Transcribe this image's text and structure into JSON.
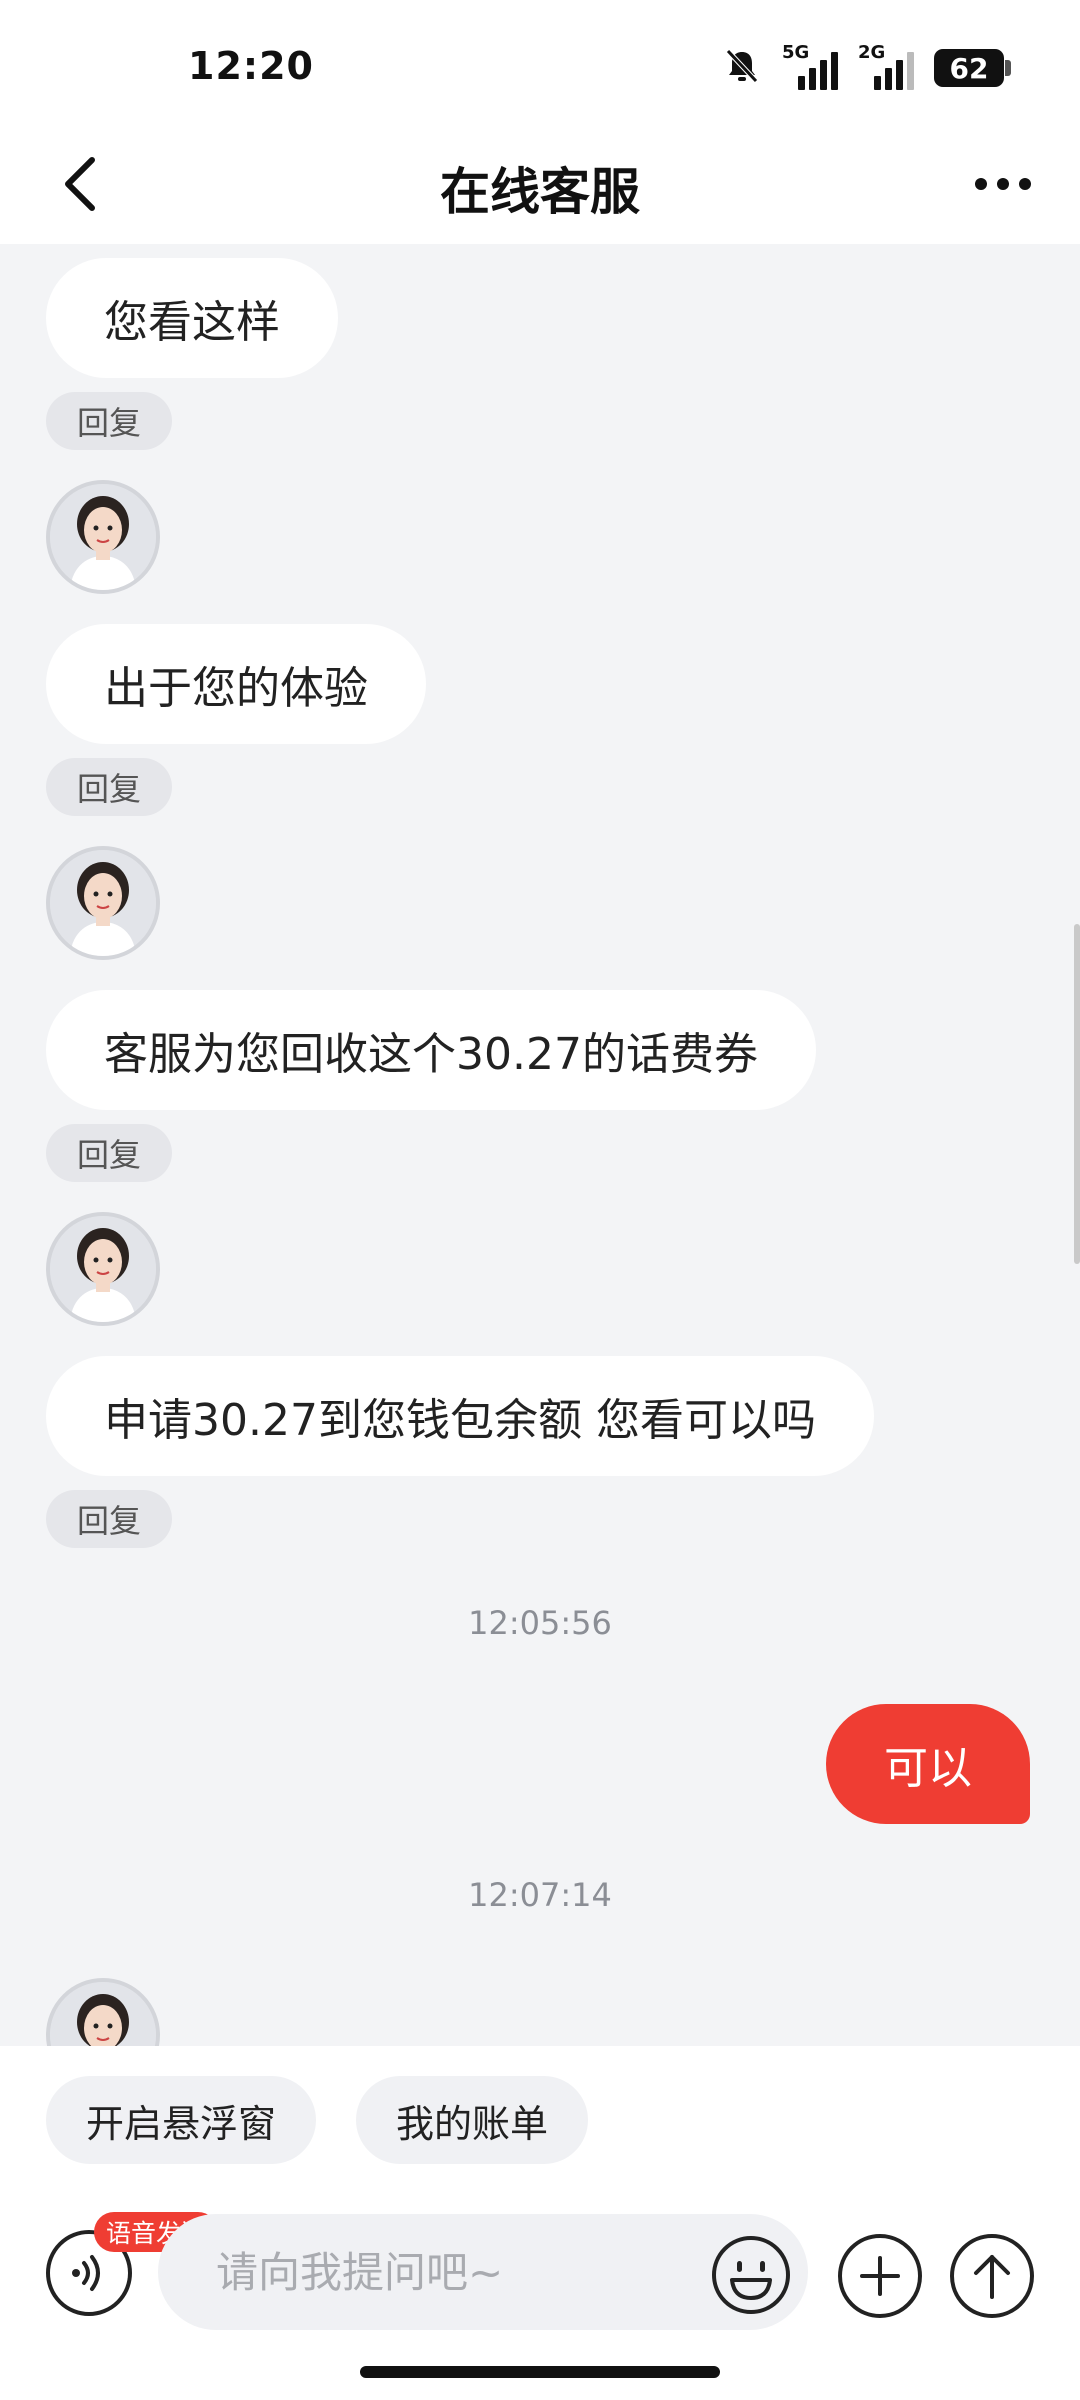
{
  "status_bar": {
    "time": "12:20",
    "signal_1": "5G",
    "signal_2": "2G",
    "battery": "62"
  },
  "nav": {
    "title": "在线客服"
  },
  "chat": {
    "messages": [
      {
        "from": "agent",
        "text": "您看这样",
        "reply": "回复"
      },
      {
        "from": "agent",
        "text": "出于您的体验",
        "reply": "回复"
      },
      {
        "from": "agent",
        "text": "客服为您回收这个30.27的话费券",
        "reply": "回复"
      },
      {
        "from": "agent",
        "text": "申请30.27到您钱包余额 您看可以吗",
        "reply": "回复"
      },
      {
        "from": "timestamp",
        "text": "12:05:56"
      },
      {
        "from": "user",
        "text": "可以"
      },
      {
        "from": "timestamp",
        "text": "12:07:14"
      }
    ]
  },
  "quick_actions": [
    "开启悬浮窗",
    "我的账单"
  ],
  "composer": {
    "voice_badge": "语音发送",
    "placeholder": "请向我提问吧~"
  },
  "colors": {
    "accent": "#ef3d33",
    "background": "#f3f4f6"
  },
  "icons": {
    "back": "chevron-left-icon",
    "more": "more-dots-icon",
    "mute": "bell-off-icon",
    "voice": "voice-wave-icon",
    "emoji": "smile-icon",
    "add": "plus-icon",
    "send": "arrow-up-icon"
  }
}
